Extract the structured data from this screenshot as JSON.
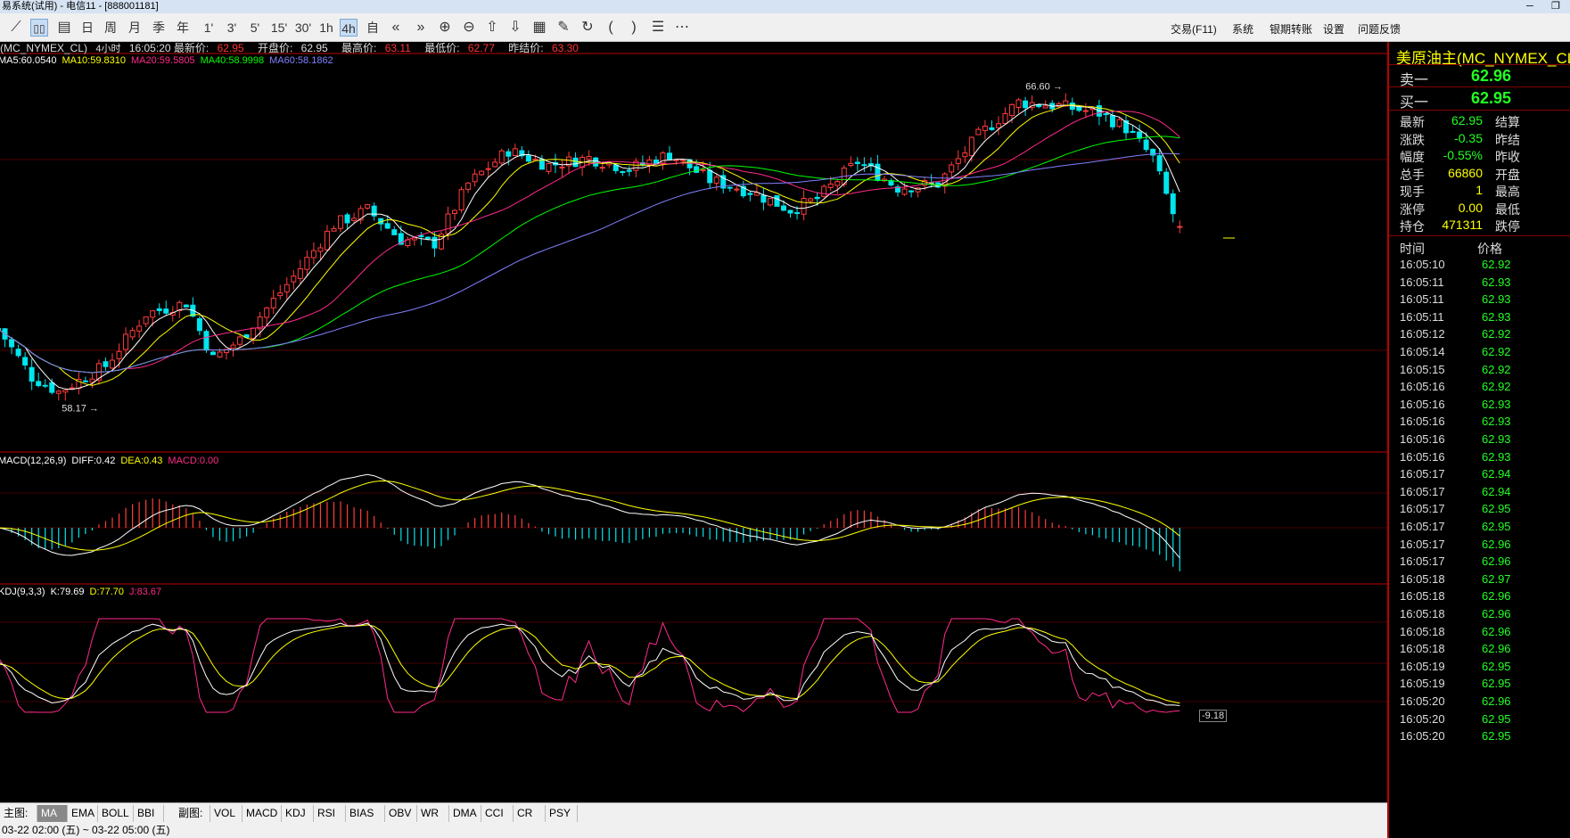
{
  "window": {
    "title": "易系统(试用) - 电信11 - [888001181]"
  },
  "toolbar": {
    "periods": [
      "日",
      "周",
      "月",
      "季",
      "年",
      "1'",
      "3'",
      "5'",
      "15'",
      "30'",
      "1h",
      "4h",
      "自"
    ],
    "active_period": "4h",
    "menu": [
      "交易(F11)",
      "系统",
      "银期转账",
      "设置",
      "问题反馈"
    ]
  },
  "header": {
    "symbol": "(MC_NYMEX_CL)",
    "period": "4小时",
    "time": "16:05:20",
    "last_label": "最新价:",
    "last": "62.95",
    "open_label": "开盘价:",
    "open": "62.95",
    "high_label": "最高价:",
    "high": "63.11",
    "low_label": "最低价:",
    "low": "62.77",
    "prev_label": "昨结价:",
    "prev": "63.30"
  },
  "ma_legend": [
    {
      "text": "MA5:60.0540",
      "color": "#ffffff"
    },
    {
      "text": "MA10:59.8310",
      "color": "#ffff00"
    },
    {
      "text": "MA20:59.5805",
      "color": "#ff2a8a"
    },
    {
      "text": "MA40:58.9998",
      "color": "#00ff00"
    },
    {
      "text": "MA60:58.1862",
      "color": "#8080ff"
    }
  ],
  "annotations": {
    "high": "66.60",
    "low": "58.17"
  },
  "macd_legend": [
    {
      "text": "MACD(12,26,9)",
      "color": "#ffffff"
    },
    {
      "text": "DIFF:0.42",
      "color": "#ffffff"
    },
    {
      "text": "DEA:0.43",
      "color": "#ffff00"
    },
    {
      "text": "MACD:0.00",
      "color": "#ff2a8a"
    }
  ],
  "kdj_legend": [
    {
      "text": "KDJ(9,3,3)",
      "color": "#ffffff"
    },
    {
      "text": "K:79.69",
      "color": "#ffffff"
    },
    {
      "text": "D:77.70",
      "color": "#ffff00"
    },
    {
      "text": "J:83.67",
      "color": "#ff2a8a"
    }
  ],
  "scale_readout": "-9.18",
  "bottom_tabs": {
    "main_label": "主图:",
    "main": [
      "MA",
      "EMA",
      "BOLL",
      "BBI"
    ],
    "main_selected": "MA",
    "sub_label": "副图:",
    "sub": [
      "VOL",
      "MACD",
      "KDJ",
      "RSI",
      "BIAS",
      "OBV",
      "WR",
      "DMA",
      "CCI",
      "CR",
      "PSY"
    ]
  },
  "status": "03-22 02:00 (五) ~ 03-22 05:00 (五)",
  "side": {
    "title": "美原油主(MC_NYMEX_CL)",
    "sell_label": "卖一",
    "sell": "62.96",
    "buy_label": "买一",
    "buy": "62.95",
    "stats": [
      {
        "label": "最新",
        "value": "62.95",
        "label2": "结算"
      },
      {
        "label": "涨跌",
        "value": "-0.35",
        "label2": "昨结"
      },
      {
        "label": "幅度",
        "value": "-0.55%",
        "label2": "昨收"
      },
      {
        "label": "总手",
        "value": "66860",
        "label2": "开盘"
      },
      {
        "label": "现手",
        "value": "1",
        "label2": "最高"
      },
      {
        "label": "涨停",
        "value": "0.00",
        "label2": "最低"
      },
      {
        "label": "持仓",
        "value": "471311",
        "label2": "跌停"
      }
    ],
    "tick_header": {
      "time": "时间",
      "price": "价格"
    },
    "ticks": [
      {
        "t": "16:05:10",
        "p": "62.92"
      },
      {
        "t": "16:05:11",
        "p": "62.93"
      },
      {
        "t": "16:05:11",
        "p": "62.93"
      },
      {
        "t": "16:05:11",
        "p": "62.93"
      },
      {
        "t": "16:05:12",
        "p": "62.92"
      },
      {
        "t": "16:05:14",
        "p": "62.92"
      },
      {
        "t": "16:05:15",
        "p": "62.92"
      },
      {
        "t": "16:05:16",
        "p": "62.92"
      },
      {
        "t": "16:05:16",
        "p": "62.93"
      },
      {
        "t": "16:05:16",
        "p": "62.93"
      },
      {
        "t": "16:05:16",
        "p": "62.93"
      },
      {
        "t": "16:05:16",
        "p": "62.93"
      },
      {
        "t": "16:05:17",
        "p": "62.94"
      },
      {
        "t": "16:05:17",
        "p": "62.94"
      },
      {
        "t": "16:05:17",
        "p": "62.95"
      },
      {
        "t": "16:05:17",
        "p": "62.95"
      },
      {
        "t": "16:05:17",
        "p": "62.96"
      },
      {
        "t": "16:05:17",
        "p": "62.96"
      },
      {
        "t": "16:05:18",
        "p": "62.97"
      },
      {
        "t": "16:05:18",
        "p": "62.96"
      },
      {
        "t": "16:05:18",
        "p": "62.96"
      },
      {
        "t": "16:05:18",
        "p": "62.96"
      },
      {
        "t": "16:05:18",
        "p": "62.96"
      },
      {
        "t": "16:05:19",
        "p": "62.95"
      },
      {
        "t": "16:05:19",
        "p": "62.95"
      },
      {
        "t": "16:05:20",
        "p": "62.96"
      },
      {
        "t": "16:05:20",
        "p": "62.95"
      },
      {
        "t": "16:05:20",
        "p": "62.95"
      }
    ]
  },
  "chart_data": {
    "type": "candlestick",
    "y_range": [
      57.6,
      67.2
    ],
    "key_points": [
      [
        0,
        60.2
      ],
      [
        5,
        58.9
      ],
      [
        9,
        58.5
      ],
      [
        16,
        59.2
      ],
      [
        22,
        60.6
      ],
      [
        28,
        60.9
      ],
      [
        32,
        59.4
      ],
      [
        36,
        59.9
      ],
      [
        44,
        61.6
      ],
      [
        50,
        63.0
      ],
      [
        55,
        63.4
      ],
      [
        60,
        62.6
      ],
      [
        65,
        62.5
      ],
      [
        70,
        64.1
      ],
      [
        76,
        65.0
      ],
      [
        82,
        64.6
      ],
      [
        88,
        64.8
      ],
      [
        94,
        64.5
      ],
      [
        100,
        64.9
      ],
      [
        106,
        64.2
      ],
      [
        112,
        63.9
      ],
      [
        118,
        63.4
      ],
      [
        122,
        63.7
      ],
      [
        128,
        64.7
      ],
      [
        134,
        64.0
      ],
      [
        140,
        64.1
      ],
      [
        146,
        65.4
      ],
      [
        152,
        66.3
      ],
      [
        158,
        66.2
      ],
      [
        164,
        66.0
      ],
      [
        168,
        65.6
      ],
      [
        172,
        64.8
      ],
      [
        175,
        63.3
      ],
      [
        176,
        62.95
      ]
    ],
    "series": [
      "MA5",
      "MA10",
      "MA20",
      "MA40",
      "MA60"
    ]
  }
}
